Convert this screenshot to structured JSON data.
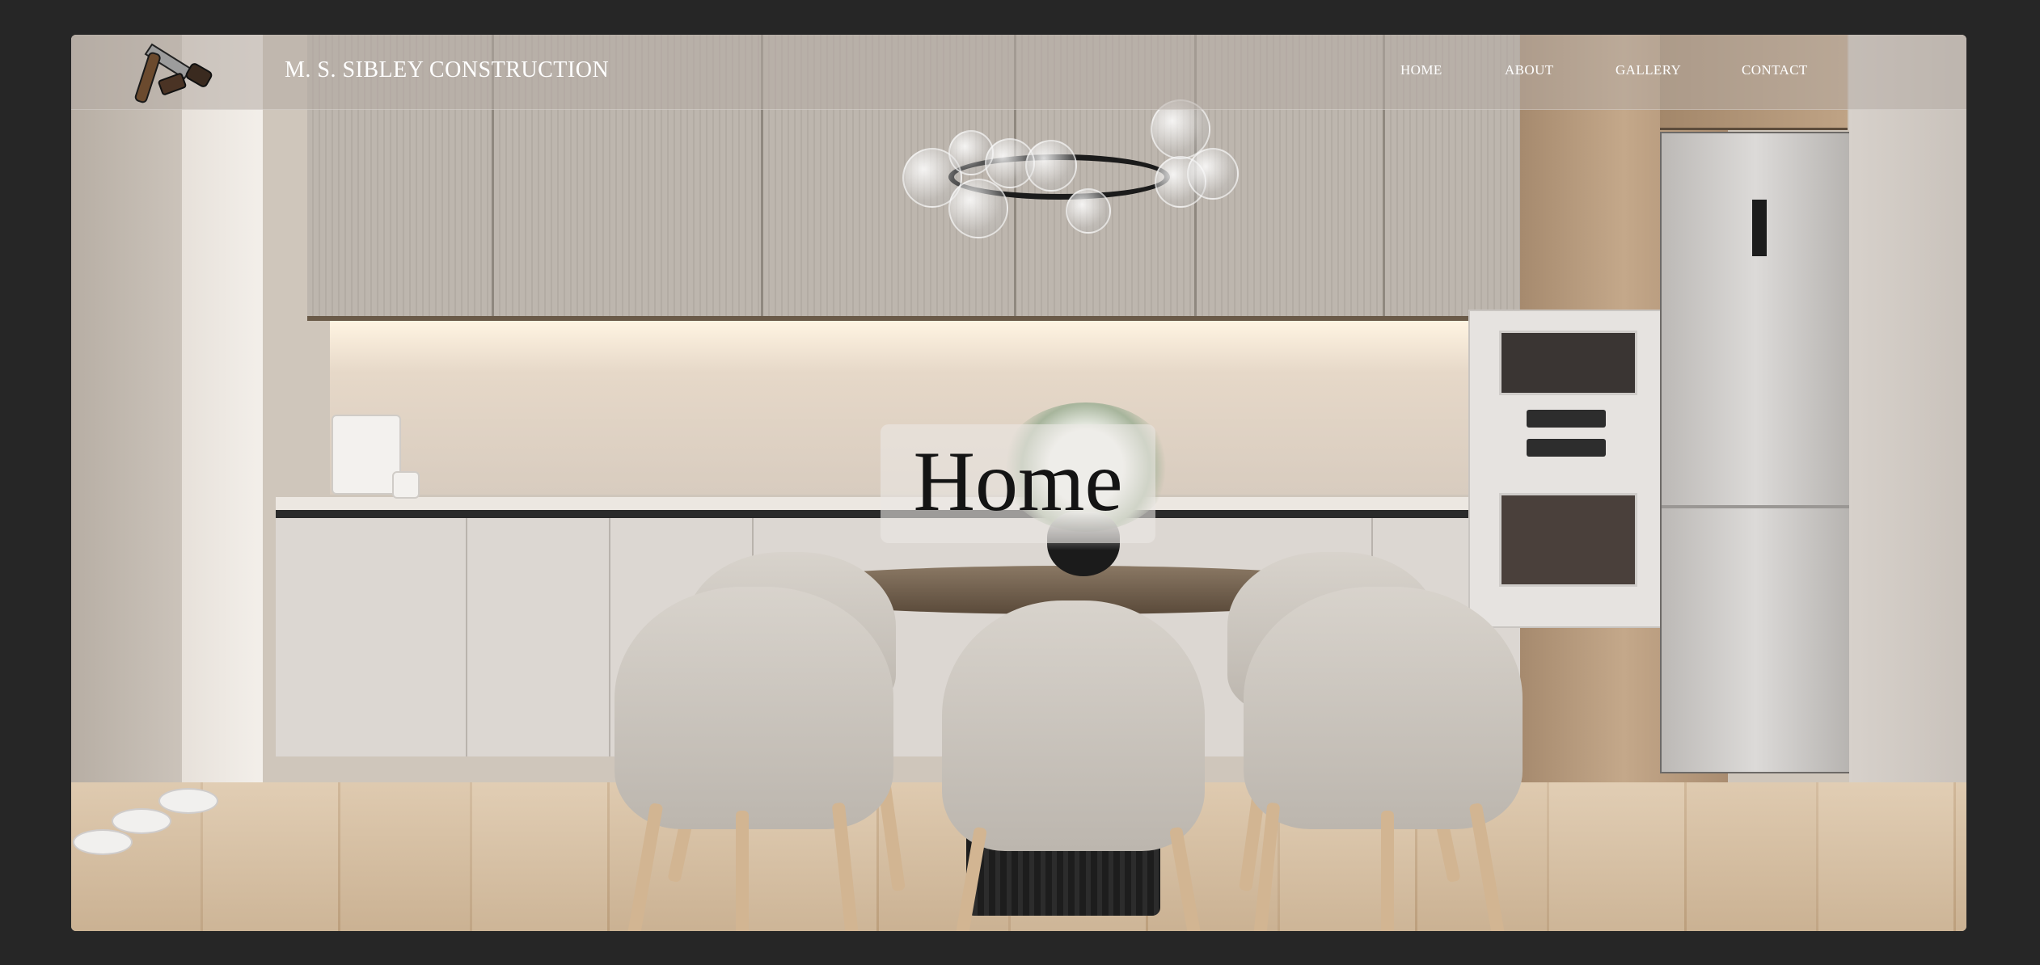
{
  "header": {
    "brand_name": "M. S. SIBLEY CONSTRUCTION",
    "logo_icon": "saw-and-hammer-icon"
  },
  "nav": {
    "items": [
      {
        "label": "HOME"
      },
      {
        "label": "ABOUT"
      },
      {
        "label": "GALLERY"
      },
      {
        "label": "CONTACT"
      }
    ]
  },
  "hero": {
    "title": "Home",
    "background_image": "modern-kitchen-dining-photo"
  },
  "colors": {
    "page_background": "#262626",
    "nav_text": "#ffffff",
    "title_text": "#141414"
  }
}
